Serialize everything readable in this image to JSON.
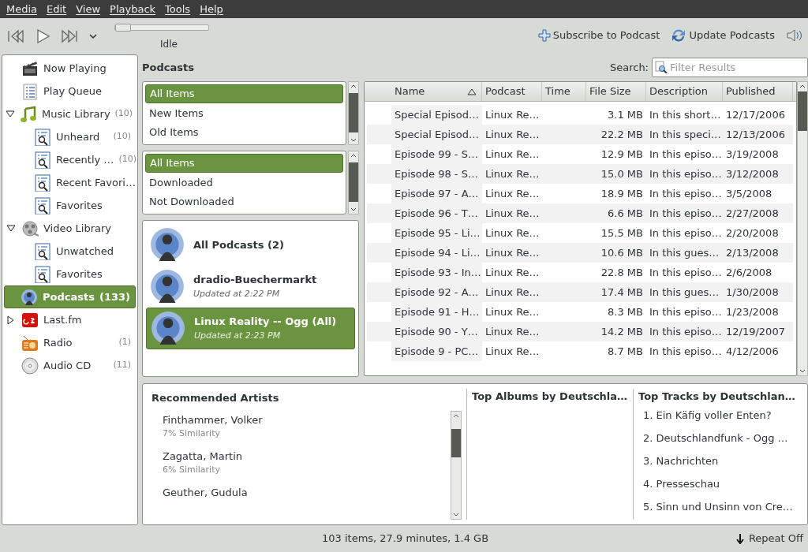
{
  "menu": [
    "Media",
    "Edit",
    "View",
    "Playback",
    "Tools",
    "Help"
  ],
  "player": {
    "seek": {
      "level": 0
    },
    "status": "Idle"
  },
  "actions": [
    {
      "label": "Subscribe to Podcast",
      "kind": "add"
    },
    {
      "label": "Update Podcasts",
      "kind": "refresh"
    }
  ],
  "sidebar": {
    "items": [
      {
        "label": "Now Playing",
        "kind": "clapper",
        "selected": false
      },
      {
        "label": "Play Queue",
        "kind": "queue",
        "selected": false
      },
      {
        "label": "Music Library",
        "kind": "music",
        "count": "(10)",
        "expanded": true,
        "selected": false,
        "children": [
          {
            "label": "Unheard",
            "kind": "smart",
            "count": "(10)",
            "selected": false
          },
          {
            "label": "Recently …",
            "kind": "smart",
            "count": "(10)",
            "selected": false
          },
          {
            "label": "Recent Favori…",
            "kind": "smart",
            "selected": false
          },
          {
            "label": "Favorites",
            "kind": "smart",
            "selected": false
          }
        ]
      },
      {
        "label": "Video Library",
        "kind": "video",
        "expanded": true,
        "selected": false,
        "children": [
          {
            "label": "Unwatched",
            "kind": "smart",
            "selected": false
          },
          {
            "label": "Favorites",
            "kind": "smart",
            "selected": false
          }
        ]
      },
      {
        "label": "Podcasts",
        "kind": "podcast",
        "count": "(133)",
        "selected": true
      },
      {
        "label": "Last.fm",
        "kind": "lastfm",
        "expanded": false,
        "selected": false
      },
      {
        "label": "Radio",
        "kind": "radio",
        "count": "(1)",
        "selected": false
      },
      {
        "label": "Audio CD",
        "kind": "cd",
        "count": "(11)",
        "selected": false
      }
    ]
  },
  "header": {
    "title": "Podcasts",
    "search_label": "Search:",
    "search": {
      "placeholder": "Filter Results"
    }
  },
  "filters": [
    [
      {
        "label": "All Items",
        "selected": true
      },
      {
        "label": "New Items",
        "selected": false
      },
      {
        "label": "Old Items",
        "selected": false
      }
    ],
    [
      {
        "label": "All Items",
        "selected": true
      },
      {
        "label": "Downloaded",
        "selected": false
      },
      {
        "label": "Not Downloaded",
        "selected": false
      }
    ]
  ],
  "feeds": [
    {
      "title": "All Podcasts (2)",
      "selected": false
    },
    {
      "title": "dradio-Buechermarkt",
      "updated": "Updated at 2:22 PM",
      "selected": false
    },
    {
      "title": "Linux Reality -- Ogg (All)",
      "updated": "Updated at 2:23 PM",
      "selected": true
    }
  ],
  "table": {
    "columns": [
      "Name",
      "Podcast",
      "Time",
      "File Size",
      "Description",
      "Published"
    ],
    "rows": [
      [
        "Special Episod…",
        "Linux Re…",
        "",
        "3.1 MB",
        "In this short…",
        "12/17/2006"
      ],
      [
        "Special Episod…",
        "Linux Re…",
        "",
        "22.2 MB",
        "In this speci…",
        "12/13/2006"
      ],
      [
        "Episode 99 - S…",
        "Linux Re…",
        "",
        "12.9 MB",
        "In this episo…",
        "3/19/2008"
      ],
      [
        "Episode 98 - S…",
        "Linux Re…",
        "",
        "15.0 MB",
        "In this episo…",
        "3/12/2008"
      ],
      [
        "Episode 97 - A…",
        "Linux Re…",
        "",
        "18.9 MB",
        "In this episo…",
        "3/5/2008"
      ],
      [
        "Episode 96 - T…",
        "Linux Re…",
        "",
        "6.6 MB",
        "In this episo…",
        "2/27/2008"
      ],
      [
        "Episode 95 - Li…",
        "Linux Re…",
        "",
        "15.5 MB",
        "In this episo…",
        "2/20/2008"
      ],
      [
        "Episode 94 - Li…",
        "Linux Re…",
        "",
        "10.6 MB",
        "In this gues…",
        "2/13/2008"
      ],
      [
        "Episode 93 - In…",
        "Linux Re…",
        "",
        "22.8 MB",
        "In this episo…",
        "2/6/2008"
      ],
      [
        "Episode 92 - A…",
        "Linux Re…",
        "",
        "17.4 MB",
        "In this gues…",
        "1/30/2008"
      ],
      [
        "Episode 91 - H…",
        "Linux Re…",
        "",
        "8.3 MB",
        "In this episo…",
        "1/23/2008"
      ],
      [
        "Episode 90 - Y…",
        "Linux Re…",
        "",
        "14.2 MB",
        "In this episo…",
        "12/19/2007"
      ],
      [
        "Episode 9 - PC…",
        "Linux Re…",
        "",
        "8.7 MB",
        "In this episo…",
        "4/12/2006"
      ]
    ]
  },
  "lastfm": {
    "artists_title": "Recommended Artists",
    "artists": [
      {
        "name": "Finthammer, Volker",
        "similarity": "7% Similarity"
      },
      {
        "name": "Zagatta, Martin",
        "similarity": "6% Similarity"
      },
      {
        "name": "Geuther, Gudula"
      }
    ],
    "albums_title": "Top Albums by Deutschla…",
    "tracks_title": "Top Tracks by Deutschlan…",
    "tracks": [
      "1. Ein Käfig voller Enten?",
      "2. Deutschlandfunk - Ogg …",
      "3. Nachrichten",
      "4. Presseschau",
      "5. Sinn und Unsinn von Cre…"
    ]
  },
  "status_bar": {
    "summary": "103 items, 27.9 minutes, 1.4 GB",
    "repeat": "Repeat Off"
  }
}
